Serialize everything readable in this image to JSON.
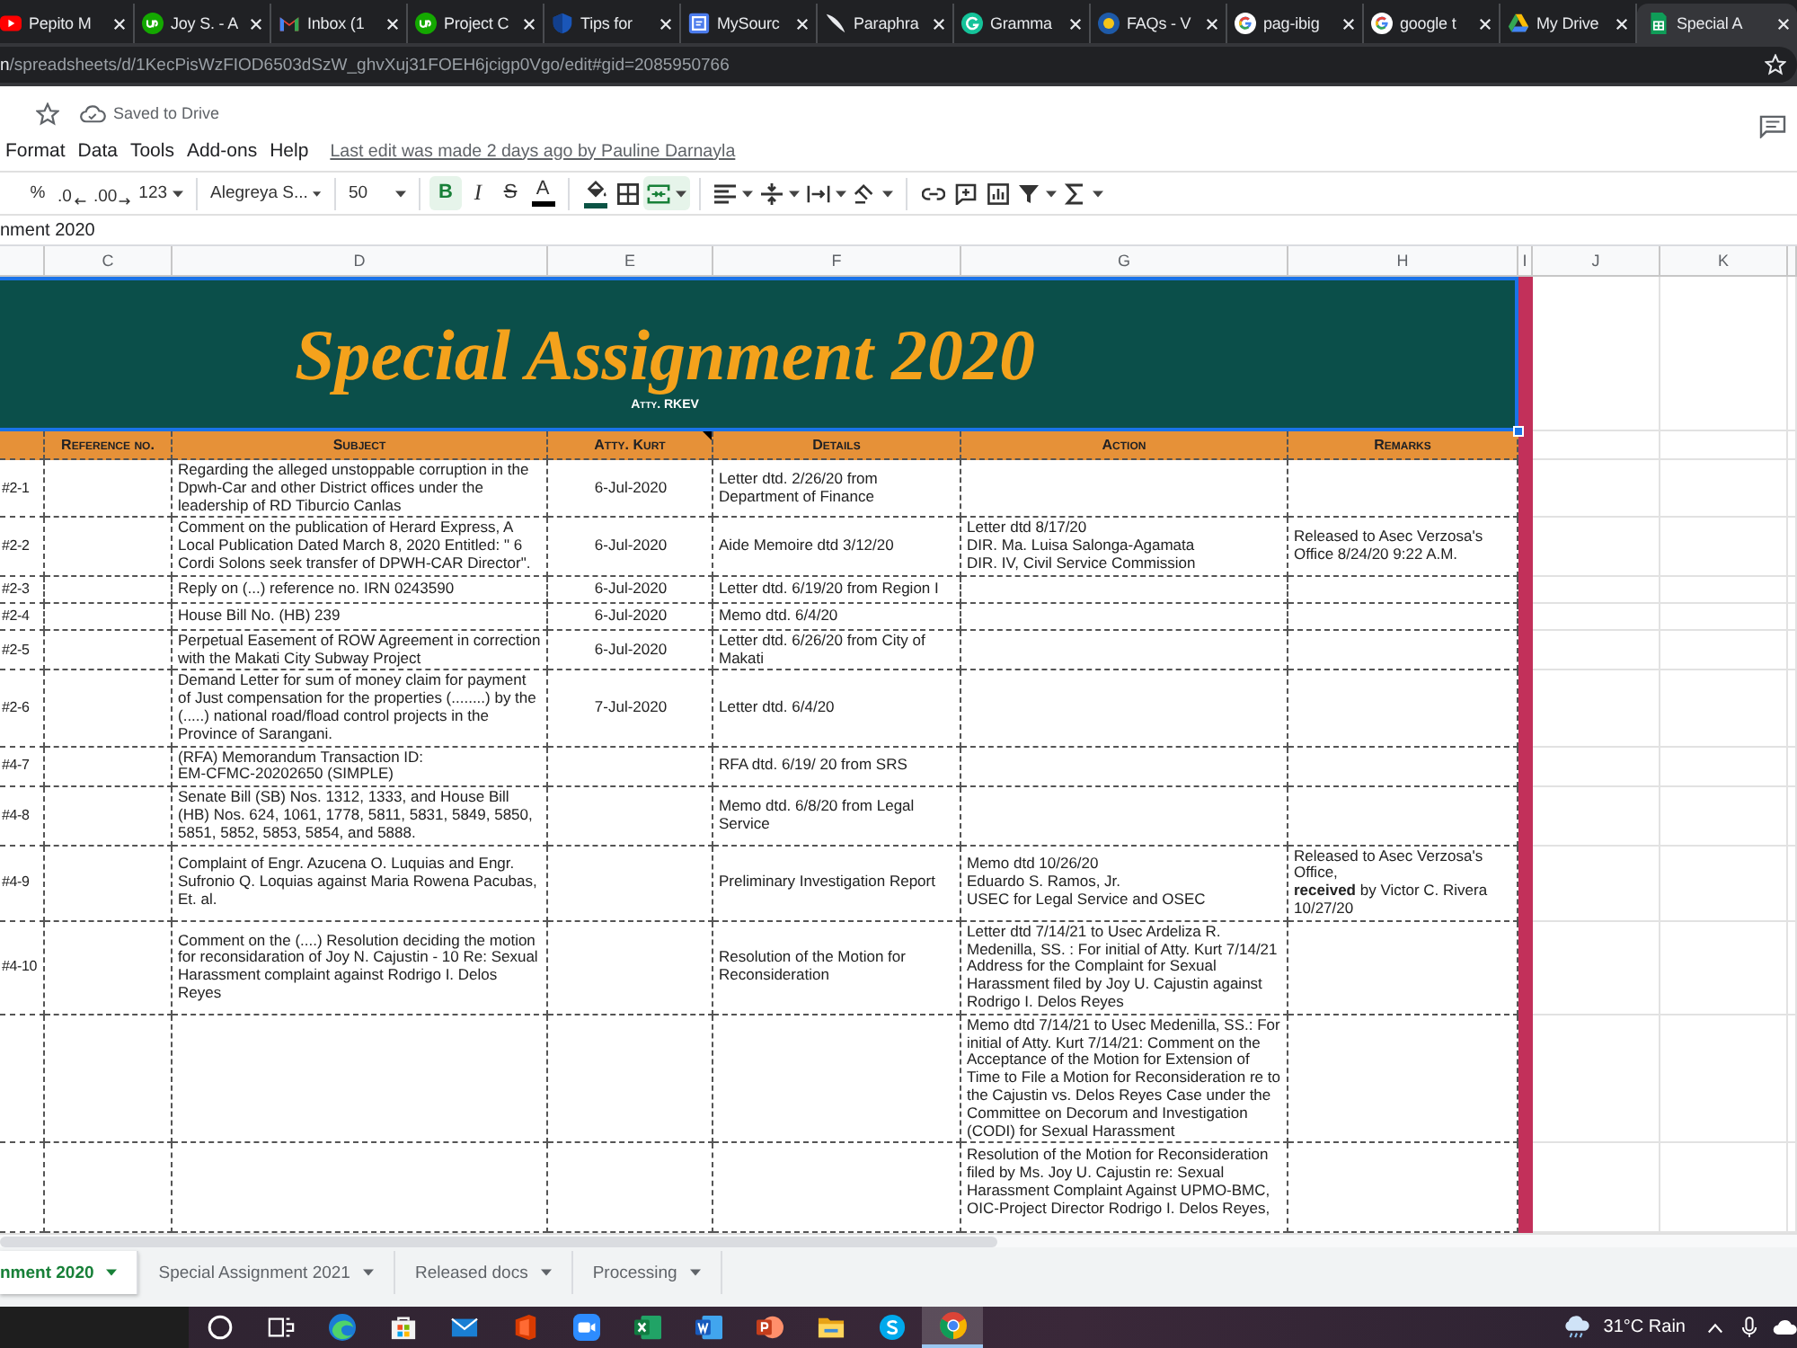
{
  "browser": {
    "tabs": [
      {
        "kind": "youtube",
        "title": "Pepito M",
        "selected": false
      },
      {
        "kind": "upwork",
        "title": "Joy S. - A",
        "selected": false
      },
      {
        "kind": "gmail",
        "title": "Inbox (1",
        "selected": false
      },
      {
        "kind": "upwork",
        "title": "Project C",
        "selected": false
      },
      {
        "kind": "shield",
        "title": "Tips for",
        "selected": false
      },
      {
        "kind": "page",
        "title": "MySourc",
        "selected": false
      },
      {
        "kind": "quill",
        "title": "Paraphra",
        "selected": false
      },
      {
        "kind": "grammarly",
        "title": "Gramma",
        "selected": false
      },
      {
        "kind": "badge",
        "title": "FAQs - V",
        "selected": false
      },
      {
        "kind": "google",
        "title": "pag-ibig",
        "selected": false
      },
      {
        "kind": "google",
        "title": "google t",
        "selected": false
      },
      {
        "kind": "drive",
        "title": "My Drive",
        "selected": false
      },
      {
        "kind": "sheets",
        "title": "Special A",
        "selected": true
      }
    ],
    "address": {
      "host": "n",
      "path": "/spreadsheets/d/1KecPisWzFIOD6503dSzW_ghvXuj31FOEH6jcigp0Vgo/edit#gid=2085950766"
    }
  },
  "docs_header": {
    "save_status": "Saved to Drive",
    "menu": [
      "Format",
      "Data",
      "Tools",
      "Add-ons",
      "Help"
    ],
    "last_edit": "Last edit was made 2 days ago by Pauline Darnayla"
  },
  "toolbar": {
    "groups": [
      [
        {
          "kind": "text",
          "label": "%",
          "on": false,
          "menu": false
        },
        {
          "kind": "decrease",
          "label": ".0",
          "on": false,
          "menu": false
        },
        {
          "kind": "increase",
          "label": ".00",
          "on": false,
          "menu": false
        },
        {
          "kind": "format",
          "label": "123",
          "on": false,
          "menu": true
        }
      ],
      [
        {
          "kind": "font",
          "label": "Alegreya S...",
          "on": false,
          "menu": true
        }
      ],
      [
        {
          "kind": "size",
          "label": "50",
          "on": false,
          "menu": true
        }
      ],
      [
        {
          "kind": "bold",
          "label": "B",
          "on": true,
          "menu": false
        },
        {
          "kind": "italic",
          "label": "I",
          "on": false,
          "menu": false
        },
        {
          "kind": "strike",
          "label": "S",
          "on": false,
          "menu": false
        },
        {
          "kind": "text_color",
          "label": "A",
          "on": false,
          "menu": false
        }
      ],
      [
        {
          "kind": "fill",
          "on": false,
          "menu": false
        },
        {
          "kind": "borders",
          "on": false,
          "menu": false
        },
        {
          "kind": "merge",
          "on": true,
          "menu": true
        }
      ],
      [
        {
          "kind": "halign",
          "on": false,
          "menu": true
        },
        {
          "kind": "valign",
          "on": false,
          "menu": true
        },
        {
          "kind": "wrap",
          "on": false,
          "menu": true
        },
        {
          "kind": "rotate",
          "on": false,
          "menu": true
        }
      ],
      [
        {
          "kind": "link",
          "on": false,
          "menu": false
        },
        {
          "kind": "comment",
          "on": false,
          "menu": false
        },
        {
          "kind": "chart",
          "on": false,
          "menu": false
        },
        {
          "kind": "filter",
          "on": false,
          "menu": true
        },
        {
          "kind": "functions",
          "on": false,
          "menu": true
        }
      ]
    ]
  },
  "formula_bar": {
    "content": "nment 2020"
  },
  "sheet": {
    "column_letters": [
      "C",
      "D",
      "E",
      "F",
      "G",
      "H",
      "I",
      "J",
      "K"
    ],
    "banner": {
      "title": "Special Assignment 2020",
      "subtitle": "Atty. RKEV"
    },
    "headers": [
      {
        "label": "Reference no.",
        "note": false
      },
      {
        "label": "Subject",
        "note": false
      },
      {
        "label": "Atty. Kurt",
        "note": true
      },
      {
        "label": "Details",
        "note": false
      },
      {
        "label": "Action",
        "note": false
      },
      {
        "label": "Remarks",
        "note": false
      }
    ],
    "rows": [
      {
        "number": "#2-1",
        "subject": "Regarding the alleged unstoppable corruption in the Dpwh-Car and other District offices under the leadership of RD Tiburcio Canlas",
        "date": "6-Jul-2020",
        "details": "Letter dtd. 2/26/20 from Department of Finance"
      },
      {
        "number": "#2-2",
        "subject": "Comment on the publication of Herard Express, A Local Publication Dated March 8, 2020 Entitled: \" 6 Cordi Solons seek transfer of DPWH-CAR Director\".",
        "date": "6-Jul-2020",
        "details": "Aide Memoire dtd 3/12/20",
        "action": "Letter dtd 8/17/20\nDIR. Ma. Luisa Salonga-Agamata\nDIR. IV, Civil Service Commission",
        "remarks": "Released to Asec Verzosa's Office 8/24/20 9:22 A.M."
      },
      {
        "number": "#2-3",
        "subject": "Reply on (...) reference no. IRN 0243590",
        "date": "6-Jul-2020",
        "details": "Letter dtd. 6/19/20 from Region I"
      },
      {
        "number": "#2-4",
        "subject": "House Bill No. (HB) 239",
        "date": "6-Jul-2020",
        "details": "Memo dtd. 6/4/20"
      },
      {
        "number": "#2-5",
        "subject": "Perpetual Easement of ROW Agreement in correction with the Makati City Subway Project",
        "date": "6-Jul-2020",
        "details": "Letter dtd. 6/26/20 from City of Makati"
      },
      {
        "number": "#2-6",
        "subject": "Demand Letter for sum of money claim for payment of Just compensation for the properties (........) by the (.....) national road/fload control projects in the Province of Sarangani.",
        "date": "7-Jul-2020",
        "details": "Letter dtd. 6/4/20"
      },
      {
        "number": "#4-7",
        "subject": "(RFA) Memorandum Transaction ID:\nEM-CFMC-20202650 (SIMPLE)",
        "details": "RFA dtd. 6/19/ 20 from SRS"
      },
      {
        "number": "#4-8",
        "subject": "Senate Bill (SB) Nos. 1312, 1333, and House Bill (HB) Nos. 624, 1061, 1778, 5811, 5831, 5849, 5850, 5851, 5852, 5853, 5854, and 5888.",
        "details": "Memo dtd. 6/8/20 from Legal Service"
      },
      {
        "number": "#4-9",
        "subject": "Complaint of Engr. Azucena O. Luquias and Engr. Sufronio Q. Loquias against Maria Rowena Pacubas, Et. al.",
        "details": "Preliminary Investigation Report",
        "action": "Memo dtd 10/26/20\nEduardo S. Ramos, Jr.\nUSEC for Legal Service and OSEC",
        "remarks": "Released to Asec Verzosa's Office,\n**received** by Victor C. Rivera 10/27/20"
      },
      {
        "number": "#4-10",
        "subject": "Comment on the (....) Resolution deciding the motion for reconsidaration of Joy N. Cajustin - 10 Re: Sexual Harassment complaint against Rodrigo I. Delos Reyes",
        "details": "Resolution of the Motion for Reconsideration",
        "action": "Letter dtd 7/14/21 to Usec Ardeliza R. Medenilla, SS. : For initial of Atty. Kurt 7/14/21 Address for the Complaint for Sexual Harassment filed by Joy U. Cajustin against Rodrigo I. Delos Reyes"
      },
      {
        "action": "Memo dtd 7/14/21 to Usec Medenilla, SS.: For initial of Atty. Kurt 7/14/21: Comment on the Acceptance of the Motion for Extension of Time to File a Motion for Reconsideration re to the Cajustin vs. Delos Reyes Case under the Committee on Decorum and Investigation (CODI) for Sexual Harassment"
      },
      {
        "action": "Resolution of the Motion for Reconsideration filed by Ms. Joy U. Cajustin re: Sexual Harassment Complaint Against UPMO-BMC, OIC-Project Director Rodrigo I. Delos Reyes,"
      }
    ]
  },
  "sheet_tabs": [
    {
      "label": "nment 2020",
      "selected": true
    },
    {
      "label": "Special Assignment 2021",
      "selected": false
    },
    {
      "label": "Released docs",
      "selected": false
    },
    {
      "label": "Processing",
      "selected": false
    }
  ],
  "taskbar": {
    "apps": [
      {
        "kind": "cortana",
        "selected": false
      },
      {
        "kind": "taskview",
        "selected": false
      },
      {
        "kind": "edge",
        "selected": false
      },
      {
        "kind": "store",
        "selected": false
      },
      {
        "kind": "mail",
        "selected": false
      },
      {
        "kind": "office",
        "selected": false
      },
      {
        "kind": "zoom",
        "selected": false
      },
      {
        "kind": "excel",
        "selected": false
      },
      {
        "kind": "word",
        "selected": false
      },
      {
        "kind": "powerpoint",
        "selected": false
      },
      {
        "kind": "explorer",
        "selected": false
      },
      {
        "kind": "skype",
        "selected": false
      },
      {
        "kind": "chrome",
        "selected": true
      }
    ],
    "weather": "31°C Rain"
  }
}
